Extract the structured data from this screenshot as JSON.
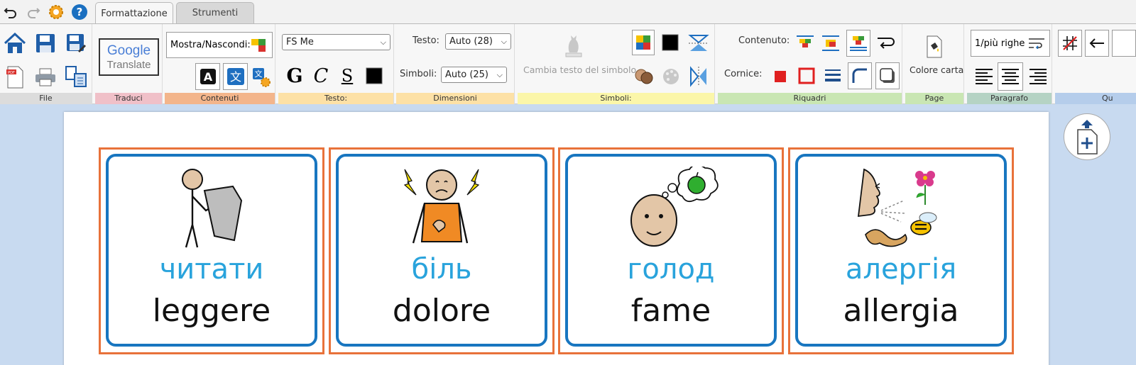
{
  "tabs": [
    "Formattazione",
    "Strumenti"
  ],
  "file": {
    "label": "File"
  },
  "traduci": {
    "label": "Traduci",
    "google": "Google",
    "translate": "Translate"
  },
  "contenuti": {
    "label": "Contenuti",
    "mostra": "Mostra/Nascondi:"
  },
  "testo": {
    "label": "Testo:",
    "font": "FS Me"
  },
  "dimensioni": {
    "label": "Dimensioni",
    "testo_label": "Testo:",
    "testo_value": "Auto (28)",
    "simboli_label": "Simboli:",
    "simboli_value": "Auto (25)"
  },
  "simboli": {
    "label": "Simboli:",
    "cambia": "Cambia testo del simbolo"
  },
  "riquadri": {
    "label": "Riquadri",
    "contenuto": "Contenuto:",
    "cornice": "Cornice:"
  },
  "page": {
    "label": "Page",
    "colore": "Colore carta"
  },
  "paragrafo": {
    "label": "Paragrafo",
    "righe": "1/più righe"
  },
  "qu": {
    "label": "Qu"
  },
  "cards": [
    {
      "ua": "читати",
      "it": "leggere",
      "symbol": "reading-person-icon"
    },
    {
      "ua": "біль",
      "it": "dolore",
      "symbol": "pain-person-icon"
    },
    {
      "ua": "голод",
      "it": "fame",
      "symbol": "hungry-head-icon"
    },
    {
      "ua": "алергія",
      "it": "allergia",
      "symbol": "allergy-icon"
    }
  ],
  "colors": {
    "ua_text": "#29a3dc",
    "card_border": "#1876c0",
    "cell_border": "#e8723a",
    "canvas": "#c8daf0"
  }
}
